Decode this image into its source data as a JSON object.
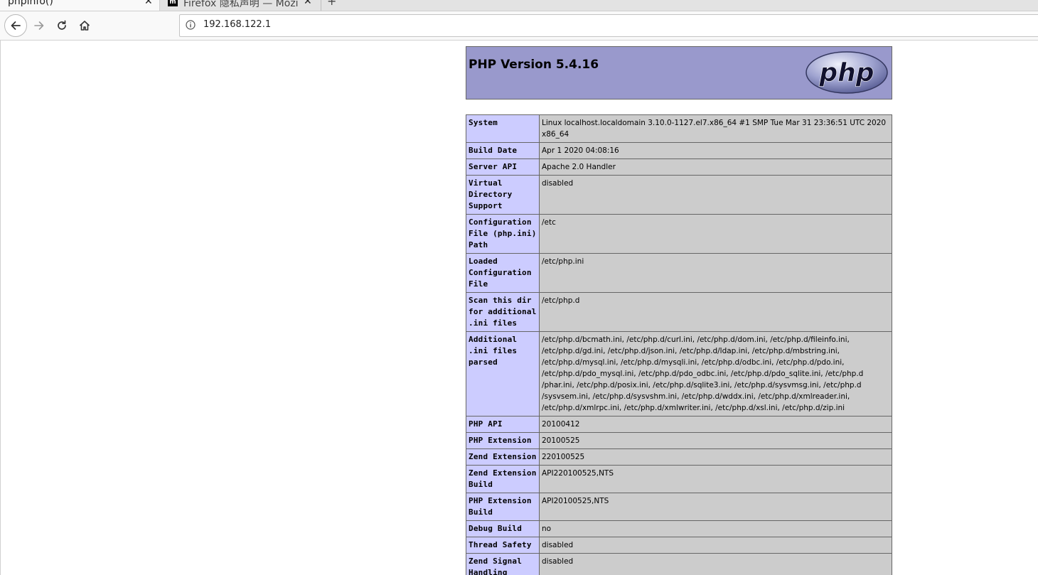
{
  "browser": {
    "tabs": [
      {
        "title": "phpinfo()",
        "active": true
      },
      {
        "title": "Firefox 隐私声明 — Mozilla",
        "active": false,
        "favicon": "m-logo-icon"
      }
    ],
    "new_tab_label": "+",
    "address": "192.168.122.1",
    "nav_icons": [
      "back-arrow-icon",
      "forward-arrow-icon",
      "reload-icon",
      "home-icon",
      "info-icon"
    ]
  },
  "page": {
    "heading": "PHP Version 5.4.16",
    "logo_text": "php",
    "colors": {
      "header_bg": "#9999cc",
      "key_bg": "#ccccff",
      "value_bg": "#cccccc"
    },
    "rows": [
      {
        "key": "System",
        "value": "Linux localhost.localdomain 3.10.0-1127.el7.x86_64 #1 SMP Tue Mar 31 23:36:51 UTC 2020 x86_64"
      },
      {
        "key": "Build Date",
        "value": "Apr 1 2020 04:08:16"
      },
      {
        "key": "Server API",
        "value": "Apache 2.0 Handler"
      },
      {
        "key": "Virtual Directory Support",
        "value": "disabled"
      },
      {
        "key": "Configuration File (php.ini) Path",
        "value": "/etc"
      },
      {
        "key": "Loaded Configuration File",
        "value": "/etc/php.ini"
      },
      {
        "key": "Scan this dir for additional .ini files",
        "value": "/etc/php.d"
      },
      {
        "key": "Additional .ini files parsed",
        "value": "/etc/php.d/bcmath.ini, /etc/php.d/curl.ini, /etc/php.d/dom.ini, /etc/php.d/fileinfo.ini, /etc/php.d/gd.ini, /etc/php.d/json.ini, /etc/php.d/ldap.ini, /etc/php.d/mbstring.ini, /etc/php.d/mysql.ini, /etc/php.d/mysqli.ini, /etc/php.d/odbc.ini, /etc/php.d/pdo.ini, /etc/php.d/pdo_mysql.ini, /etc/php.d/pdo_odbc.ini, /etc/php.d/pdo_sqlite.ini, /etc/php.d /phar.ini, /etc/php.d/posix.ini, /etc/php.d/sqlite3.ini, /etc/php.d/sysvmsg.ini, /etc/php.d /sysvsem.ini, /etc/php.d/sysvshm.ini, /etc/php.d/wddx.ini, /etc/php.d/xmlreader.ini, /etc/php.d/xmlrpc.ini, /etc/php.d/xmlwriter.ini, /etc/php.d/xsl.ini, /etc/php.d/zip.ini"
      },
      {
        "key": "PHP API",
        "value": "20100412"
      },
      {
        "key": "PHP Extension",
        "value": "20100525"
      },
      {
        "key": "Zend Extension",
        "value": "220100525"
      },
      {
        "key": "Zend Extension Build",
        "value": "API220100525,NTS"
      },
      {
        "key": "PHP Extension Build",
        "value": "API20100525,NTS"
      },
      {
        "key": "Debug Build",
        "value": "no"
      },
      {
        "key": "Thread Safety",
        "value": "disabled"
      },
      {
        "key": "Zend Signal Handling",
        "value": "disabled"
      }
    ]
  }
}
